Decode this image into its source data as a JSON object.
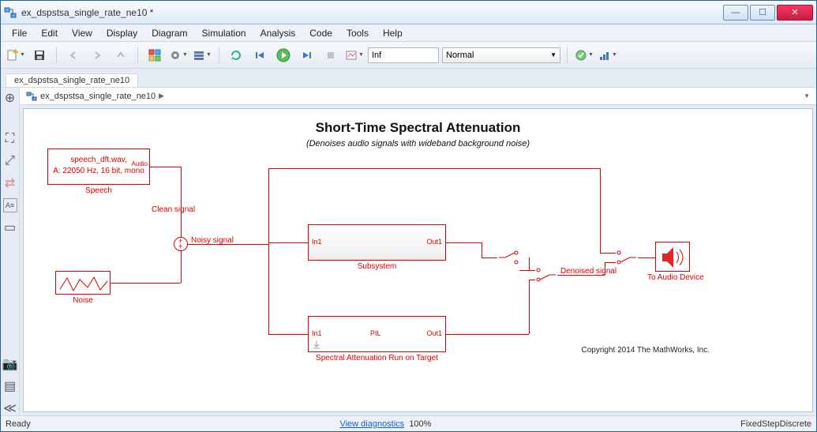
{
  "window": {
    "title": "ex_dspstsa_single_rate_ne10 *"
  },
  "menu": [
    "File",
    "Edit",
    "View",
    "Display",
    "Diagram",
    "Simulation",
    "Analysis",
    "Code",
    "Tools",
    "Help"
  ],
  "toolbar": {
    "stop_time": "Inf",
    "sim_mode": "Normal"
  },
  "tab": {
    "label": "ex_dspstsa_single_rate_ne10"
  },
  "breadcrumb": {
    "model": "ex_dspstsa_single_rate_ne10"
  },
  "diagram": {
    "title": "Short-Time Spectral Attenuation",
    "subtitle": "(Denoises audio signals with wideband background noise)",
    "speech_block": {
      "line1": "speech_dft.wav,",
      "line2": "A: 22050 Hz, 16 bit, mono",
      "corner": "Audio",
      "name": "Speech"
    },
    "noise_block": {
      "name": "Noise"
    },
    "sum_labels": {
      "top": "Clean signal",
      "out": "Noisy signal"
    },
    "subsystem": {
      "in": "In1",
      "out": "Out1",
      "name": "Subsystem"
    },
    "pil": {
      "in": "In1",
      "mid": "PIL",
      "out": "Out1",
      "name": "Spectral Attenuation Run on Target"
    },
    "denoised": "Denoised signal",
    "sink": {
      "name": "To Audio Device"
    },
    "copyright": "Copyright 2014 The MathWorks, Inc."
  },
  "status": {
    "ready": "Ready",
    "diagnostics": "View diagnostics",
    "progress": "100%",
    "solver": "FixedStepDiscrete"
  }
}
